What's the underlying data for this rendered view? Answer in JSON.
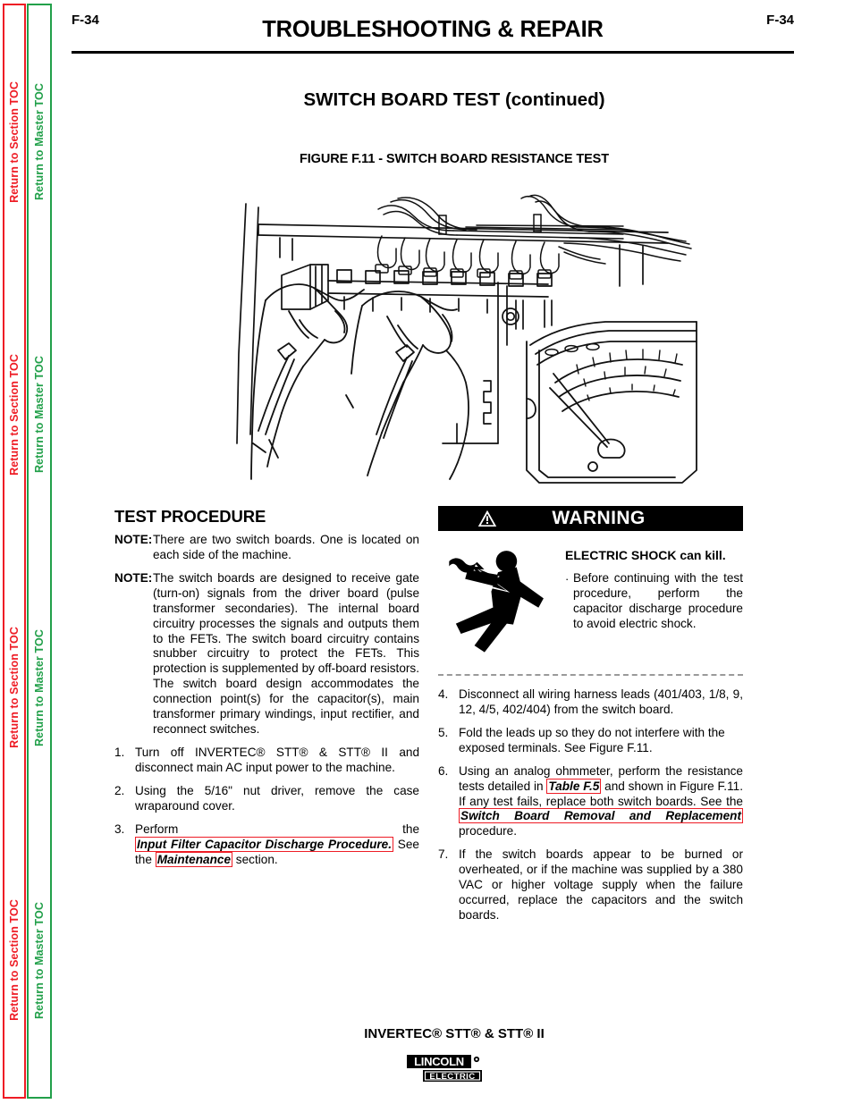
{
  "sidebar": {
    "section_toc_label": "Return to Section TOC",
    "master_toc_label": "Return to Master TOC",
    "section_toc_color": "#ee1c25",
    "master_toc_color": "#22a04a",
    "repeat_count": 4
  },
  "header": {
    "page_number_left": "F-34",
    "page_number_right": "F-34",
    "title": "TROUBLESHOOTING & REPAIR"
  },
  "section": {
    "title": "SWITCH BOARD TEST (continued)",
    "figure_caption": "FIGURE F.11 - SWITCH BOARD RESISTANCE TEST"
  },
  "figure": {
    "alt": "Line drawing: two gloved hands holding ohmmeter probes against the terminals of a switch board, wiring harness leads folded up above, analog ohmmeter with needle gauge at right"
  },
  "left_column": {
    "heading": "TEST PROCEDURE",
    "notes": [
      {
        "tag": "NOTE:",
        "text": "There are two switch boards.  One is located on each side of the machine."
      },
      {
        "tag": "NOTE:",
        "text": "The switch boards are designed to receive gate (turn-on) signals from the driver board (pulse transformer secondaries). The internal board circuitry processes the signals and outputs them to the FETs.  The switch board circuitry contains snubber circuitry to protect the FETs.  This protection is supplemented by off-board resistors. The switch board design accommodates the connection point(s) for the capacitor(s), main transformer primary windings, input rectifier, and reconnect switches."
      }
    ],
    "steps": [
      {
        "num": "1.",
        "text": "Turn off INVERTEC® STT® & STT® II and disconnect main AC input power to the machine."
      },
      {
        "num": "2.",
        "text": "Using the 5/16\" nut driver, remove the case wraparound cover."
      },
      {
        "num": "3.",
        "pre": "Perform  the  ",
        "link1": "Input  Filter  Capacitor Discharge  Procedure.",
        "mid": "  See  the  ",
        "link2": "Maintenance",
        "post": " section."
      }
    ]
  },
  "warning": {
    "banner_label": "WARNING",
    "banner_bg": "#000000",
    "icon_name": "warning-triangle-icon",
    "shock_icon_name": "electric-shock-icon",
    "headline": "ELECTRIC SHOCK can kill.",
    "bullet_marker": "·",
    "bullet_text": "Before continuing with the test procedure, perform the capacitor discharge procedure to avoid electric shock."
  },
  "right_column": {
    "steps": [
      {
        "num": "4.",
        "text": "Disconnect all wiring harness leads (401/403, 1/8, 9, 12, 4/5, 402/404) from the switch board."
      },
      {
        "num": "5.",
        "text": "Fold the leads up so they do not interfere with the exposed terminals. See Figure F.11."
      },
      {
        "num": "6.",
        "pre": "Using an analog ohmmeter, perform the resistance tests detailed in ",
        "link1": "Table F.5",
        "mid": " and shown in Figure F.11.   If any test fails, replace both switch boards.  See the ",
        "link2": "Switch Board Removal and Replacement",
        "post": " procedure."
      },
      {
        "num": "7.",
        "text": "If the switch boards appear to be burned or overheated, or if the machine was supplied by a 380 VAC or higher voltage supply when the failure occurred, replace the capacitors and the switch boards."
      }
    ]
  },
  "footer": {
    "model": "INVERTEC® STT® & STT® II",
    "logo_top": "LINCOLN",
    "logo_bottom": "ELECTRIC",
    "logo_registered": "®"
  }
}
